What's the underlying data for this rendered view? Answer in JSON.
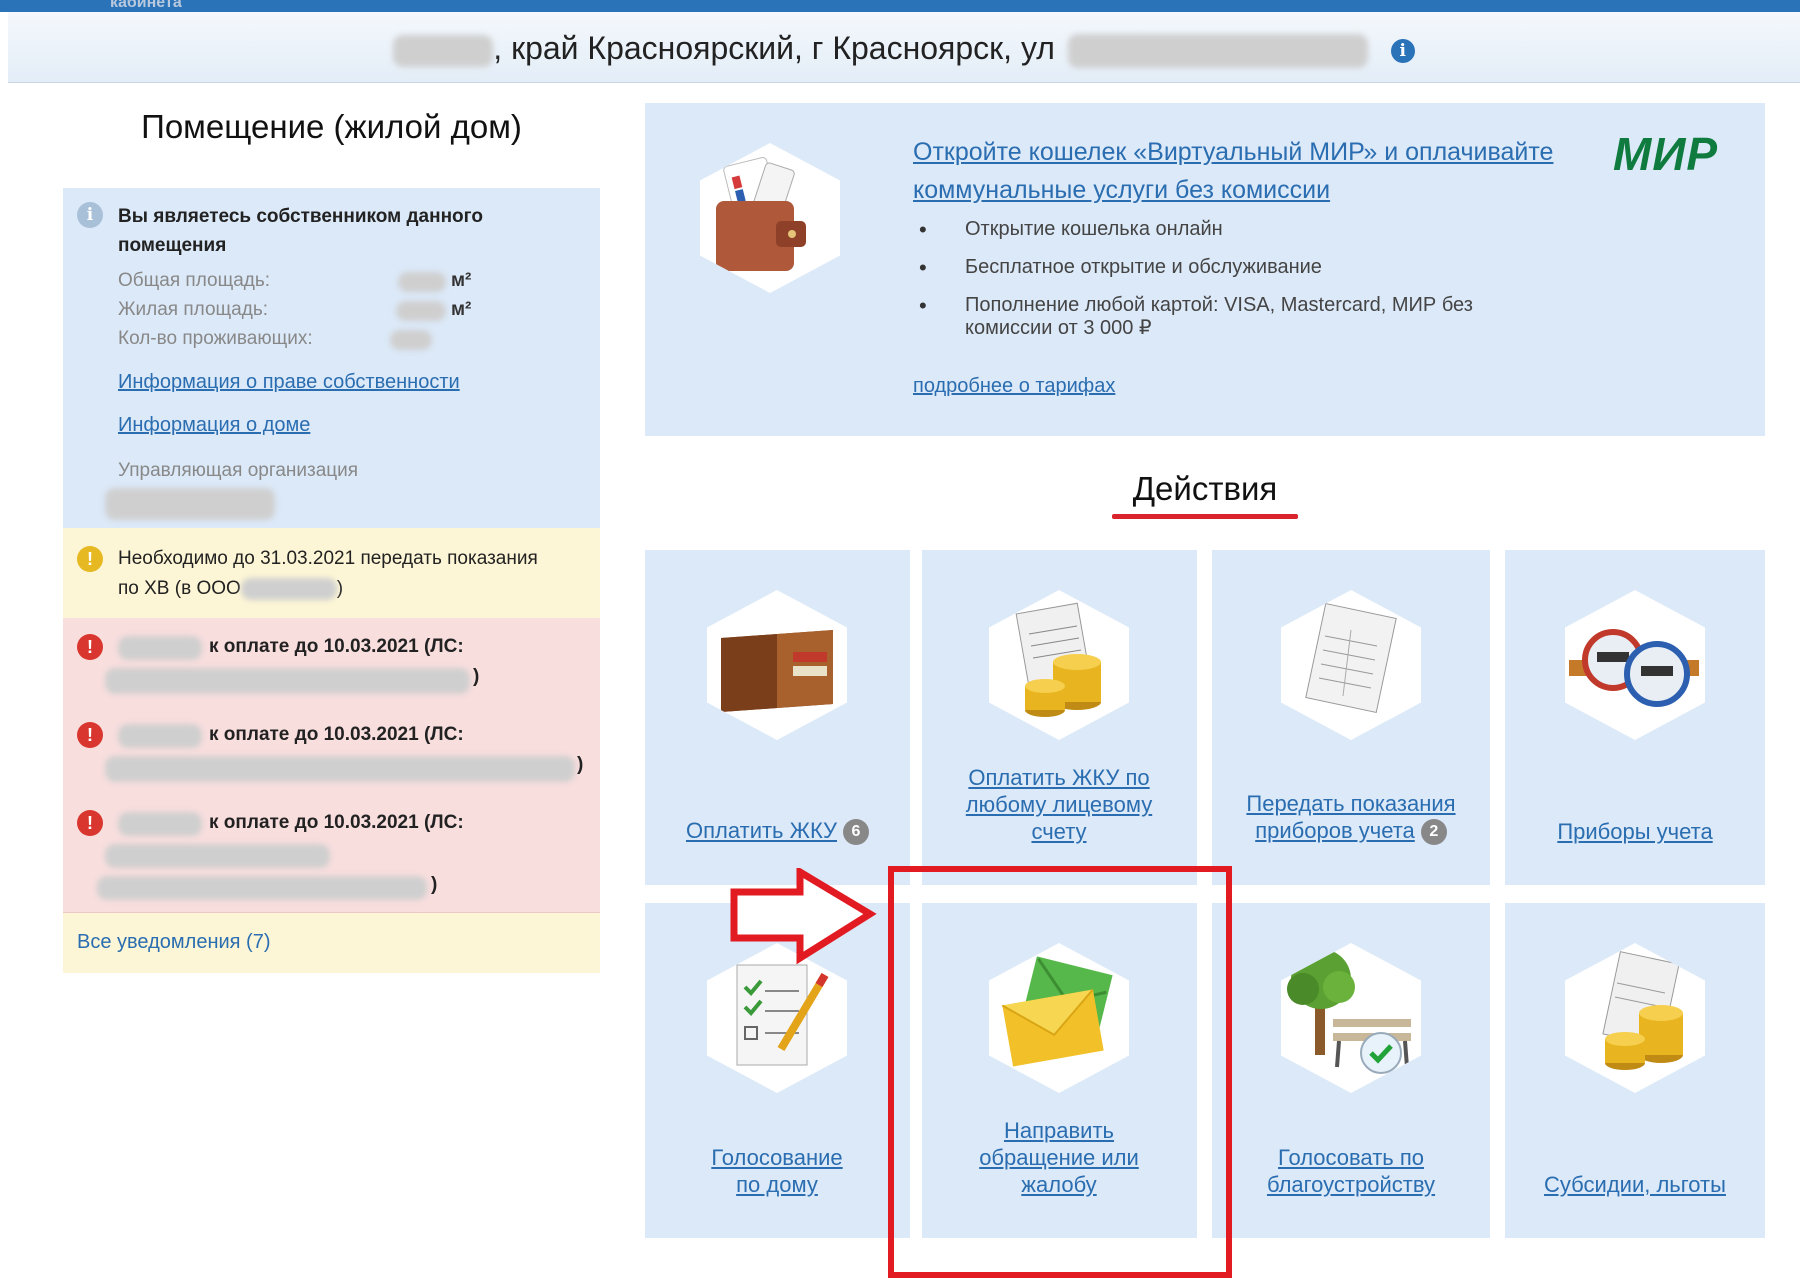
{
  "header": {
    "cut_text": "кабинета",
    "address_visible": ", край Красноярский, г Красноярск, ул",
    "info_icon": "i"
  },
  "premises": {
    "title": "Помещение (жилой дом)",
    "owner_message": "Вы являетесь собственником данного помещения",
    "total_area_label": "Общая площадь:",
    "living_area_label": "Жилая площадь:",
    "residents_label": "Кол-во проживающих:",
    "area_unit": "м²",
    "ownership_link": "Информация о праве собственности",
    "house_link": "Информация о доме",
    "management_label": "Управляющая организация"
  },
  "notifications": {
    "warning_text_1": "Необходимо до 31.03.2021 передать показания",
    "warning_text_2": "по ХВ (в ООО",
    "debt_items": [
      {
        "text": "к оплате до 10.03.2021 (ЛС:"
      },
      {
        "text": "к оплате до 10.03.2021 (ЛС:"
      },
      {
        "text": "к оплате до 10.03.2021 (ЛС:"
      }
    ],
    "all_link": "Все уведомления (7)"
  },
  "promo": {
    "link_text": "Откройте кошелек «Виртуальный МИР» и оплачивайте коммунальные услуги без комиссии",
    "logo": "МИР",
    "bullets": [
      "Открытие кошелька онлайн",
      "Бесплатное открытие и обслуживание",
      "Пополнение любой картой: VISA, Mastercard, МИР без комиссии от 3 000 ₽"
    ],
    "more_link": "подробнее о тарифах"
  },
  "actions": {
    "title": "Действия",
    "tiles": [
      {
        "label": "Оплатить ЖКУ",
        "badge": "6",
        "icon": "wallet-icon"
      },
      {
        "label": "Оплатить ЖКУ по любому лицевому счету",
        "badge": "",
        "icon": "bill-coins-icon"
      },
      {
        "label": "Передать показания приборов учета",
        "badge": "2",
        "icon": "meter-form-icon"
      },
      {
        "label": "Приборы учета",
        "badge": "",
        "icon": "water-meter-icon"
      },
      {
        "label": "Голосование по дому",
        "badge": "",
        "icon": "checklist-icon"
      },
      {
        "label": "Направить обращение или жалобу",
        "badge": "",
        "icon": "envelope-icon"
      },
      {
        "label": "Голосовать по благоустройству",
        "badge": "",
        "icon": "tree-bench-icon"
      },
      {
        "label": "Субсидии, льготы",
        "badge": "",
        "icon": "subsidy-coins-icon"
      }
    ]
  },
  "colors": {
    "accent_blue": "#2a6db0",
    "tile_bg": "#dce9f8",
    "warning_bg": "#fdf6d6",
    "error_bg": "#f9dede",
    "annotation_red": "#e21b22",
    "mir_green": "#0f7b3f"
  }
}
